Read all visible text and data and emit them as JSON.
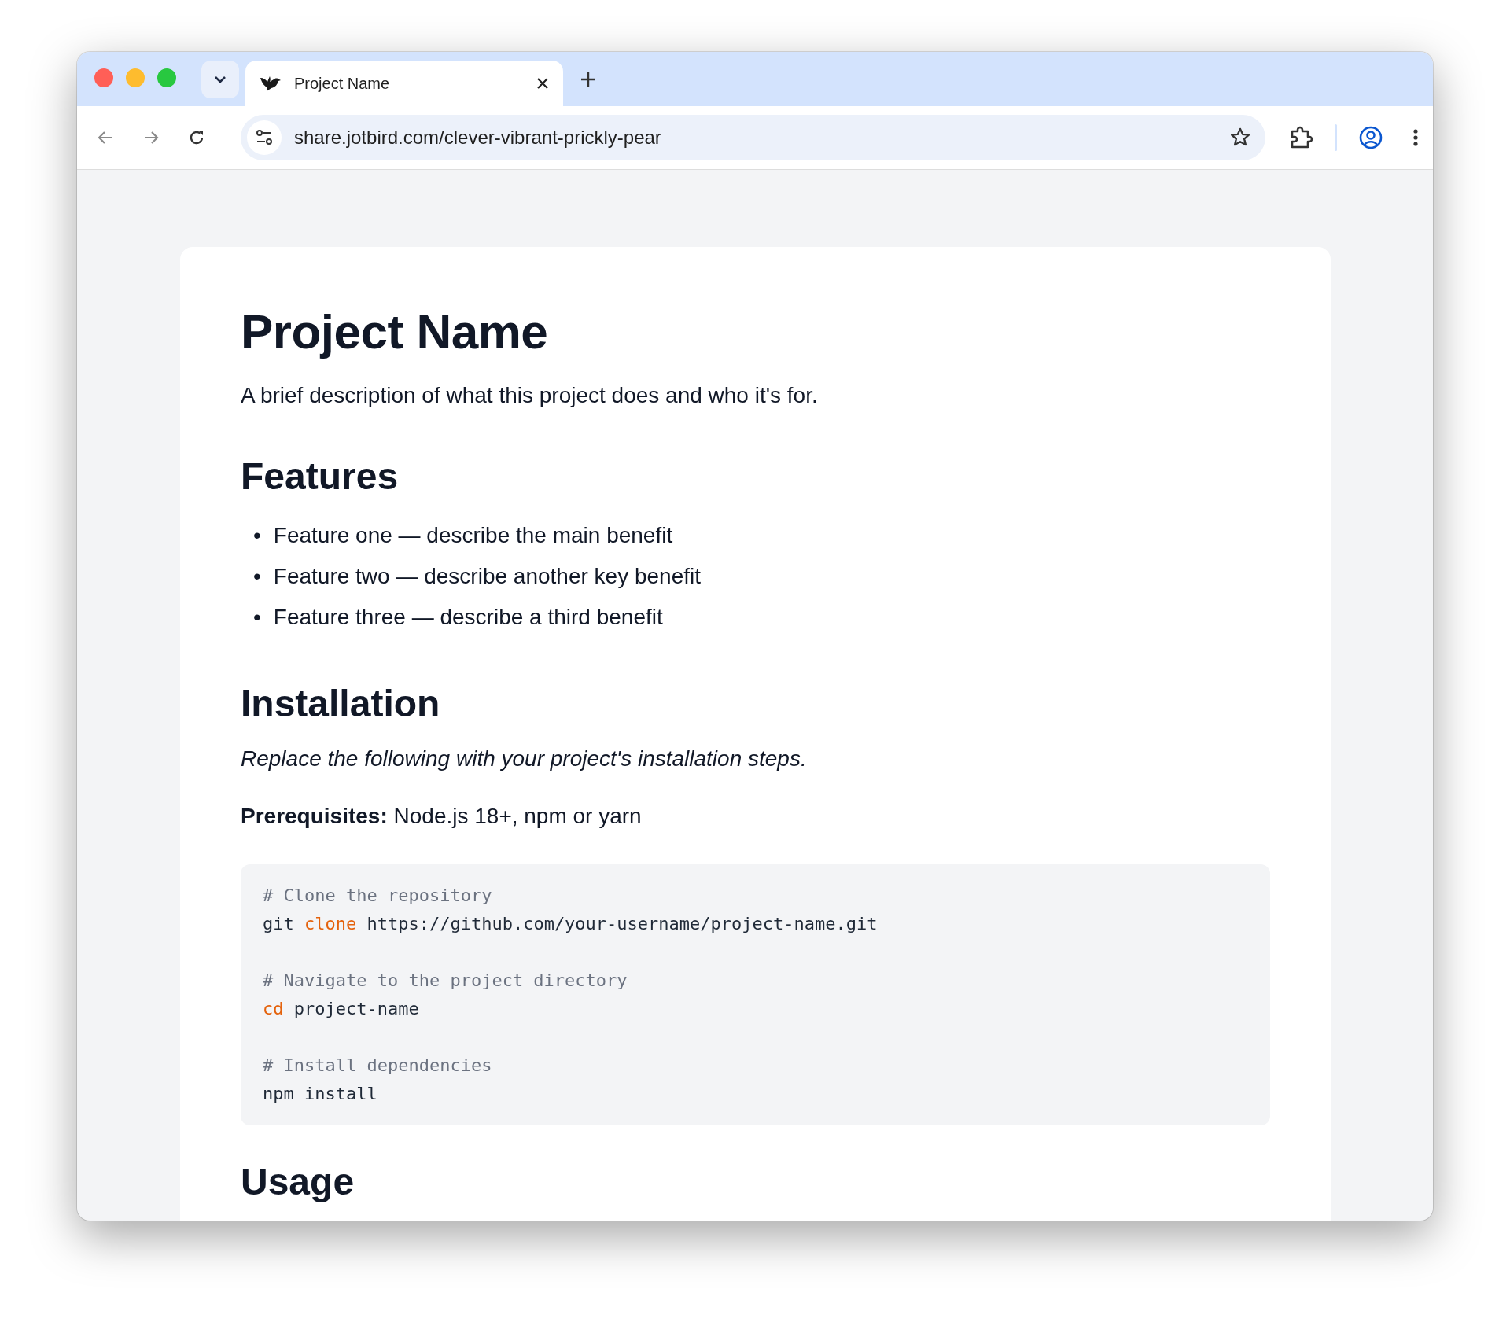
{
  "tabs": [
    {
      "title": "Project Name",
      "selected": true
    }
  ],
  "address_bar": {
    "url": "share.jotbird.com/clever-vibrant-prickly-pear"
  },
  "document": {
    "blocks": [
      {
        "kind": "title",
        "text": "Project Name"
      },
      {
        "kind": "paragraph",
        "text": "A brief description of what this project does and who it's for."
      },
      {
        "kind": "heading",
        "text": "Features"
      },
      {
        "kind": "list",
        "items": [
          {
            "bullet": "•",
            "text": "Feature one — describe the main benefit"
          },
          {
            "bullet": "•",
            "text": "Feature two — describe another key benefit"
          },
          {
            "bullet": "•",
            "text": "Feature three — describe a third benefit"
          }
        ]
      },
      {
        "kind": "heading",
        "text": "Installation"
      },
      {
        "kind": "note",
        "text": "Replace the following with your project's installation steps."
      },
      {
        "kind": "paragraph",
        "text": "**Prerequisites:** Node.js 18+, npm or yarn"
      },
      {
        "kind": "code",
        "lines": [
          {
            "kind": "comment",
            "segments": [
              {
                "kind": "comment",
                "text": "# Clone the repository"
              }
            ]
          },
          {
            "kind": "command",
            "segments": [
              {
                "kind": "plain",
                "text": "git "
              },
              {
                "kind": "keyword",
                "text": "clone"
              },
              {
                "kind": "plain",
                "text": " https://github.com/your-username/project-name.git"
              }
            ]
          },
          {
            "kind": "blank"
          },
          {
            "kind": "comment",
            "segments": [
              {
                "kind": "comment",
                "text": "# Navigate to the project directory"
              }
            ]
          },
          {
            "kind": "command",
            "segments": [
              {
                "kind": "keyword",
                "text": "cd"
              },
              {
                "kind": "plain",
                "text": " project-name"
              }
            ]
          },
          {
            "kind": "blank"
          },
          {
            "kind": "comment",
            "segments": [
              {
                "kind": "comment",
                "text": "# Install dependencies"
              }
            ]
          },
          {
            "kind": "command",
            "segments": [
              {
                "kind": "plain",
                "text": "npm install"
              }
            ]
          }
        ]
      },
      {
        "kind": "heading",
        "text": "Usage"
      }
    ]
  }
}
